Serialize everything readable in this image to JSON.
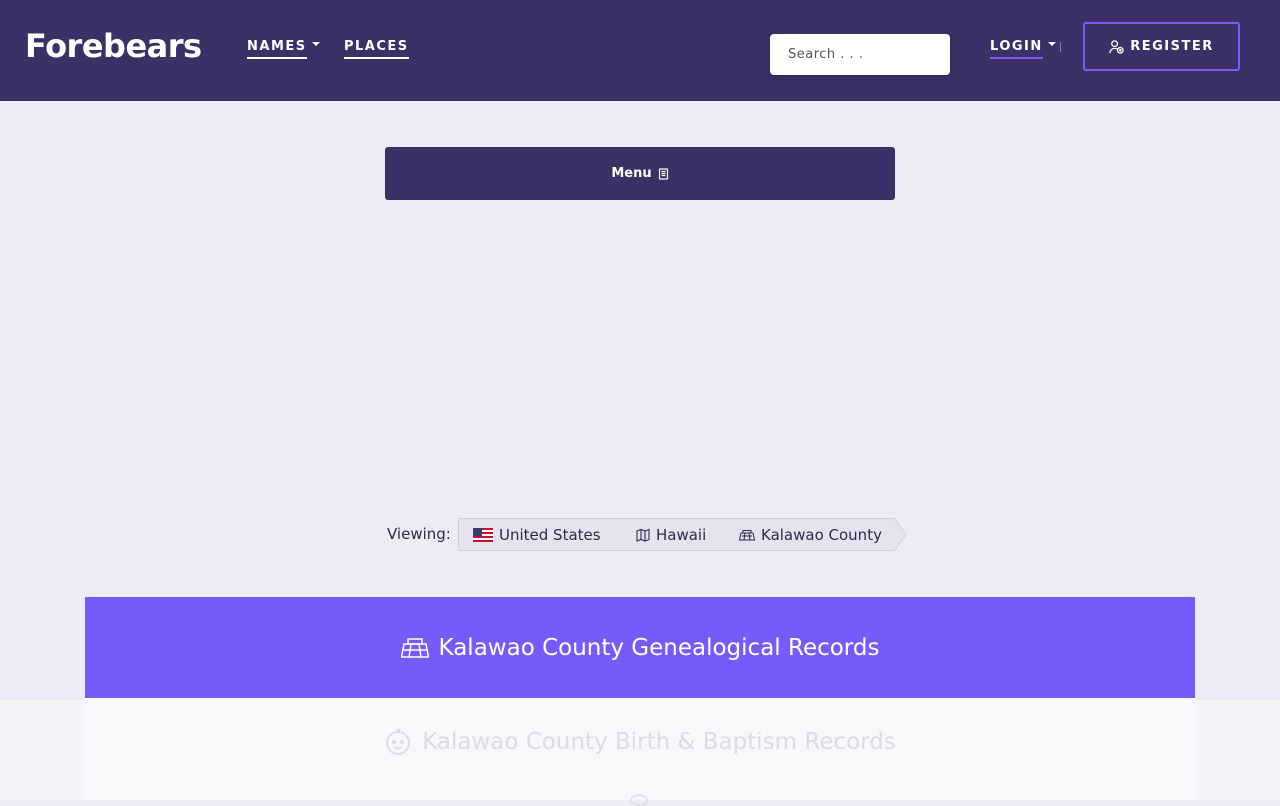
{
  "header": {
    "logo": "Forebears",
    "nav": {
      "names": "NAMES",
      "places": "PLACES",
      "login": "LOGIN"
    },
    "search_placeholder": "Search . . .",
    "register": "REGISTER"
  },
  "menu": {
    "label": "Menu"
  },
  "breadcrumb": {
    "prefix": "Viewing:",
    "items": [
      "United States",
      "Hawaii",
      "Kalawao County"
    ]
  },
  "content": {
    "title": "Kalawao County Genealogical Records",
    "section_title": "Kalawao County Birth & Baptism Records"
  },
  "colors": {
    "header_bg": "#3c3166",
    "accent": "#745cfb",
    "page_bg": "#edebf5"
  },
  "icons": {
    "register": "user-plus-icon",
    "menu": "book-icon",
    "country": "us-flag-icon",
    "state": "map-icon",
    "county": "county-map-icon",
    "birth": "baby-face-icon"
  }
}
